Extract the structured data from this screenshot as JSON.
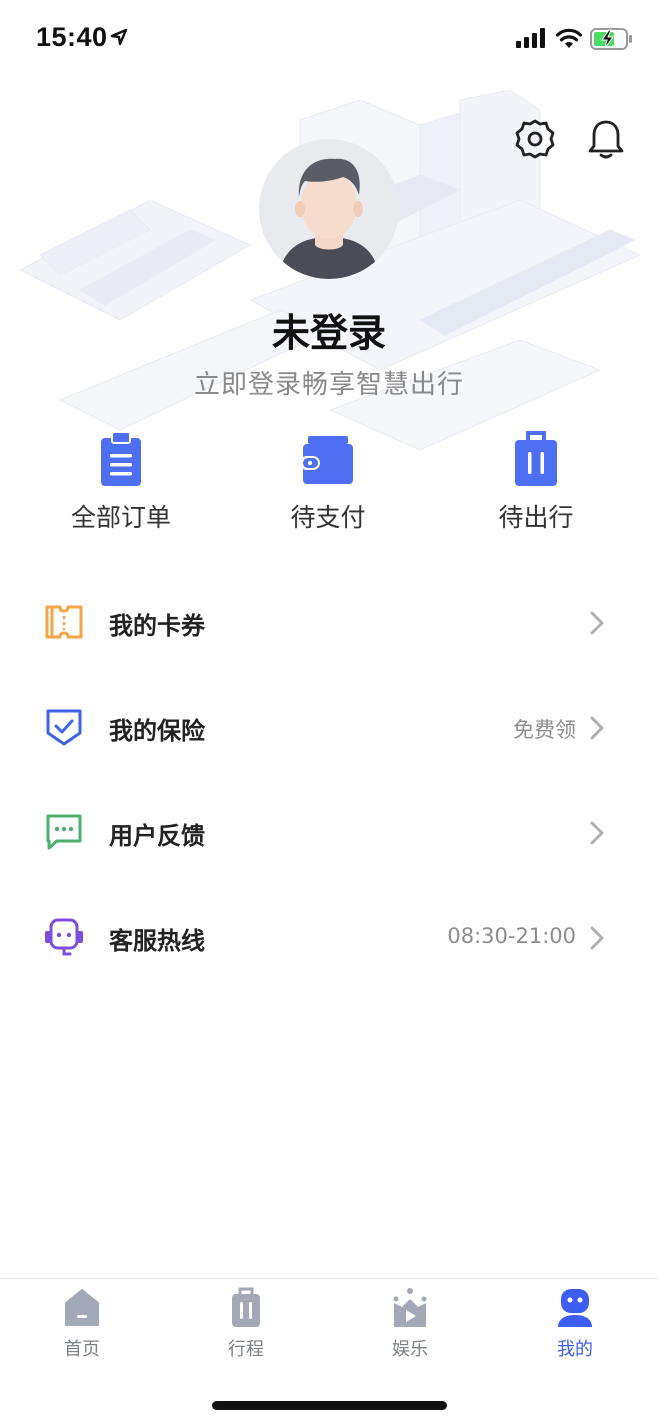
{
  "status_bar": {
    "time": "15:40",
    "location_icon": "location-arrow-icon",
    "signal_icon": "cellular-signal-icon",
    "wifi_icon": "wifi-icon",
    "battery_icon": "battery-charging-icon"
  },
  "header": {
    "settings_icon": "gear-icon",
    "notification_icon": "bell-icon",
    "title": "未登录",
    "subtitle": "立即登录畅享智慧出行"
  },
  "orders": [
    {
      "label": "全部订单",
      "icon": "clipboard-icon"
    },
    {
      "label": "待支付",
      "icon": "wallet-icon"
    },
    {
      "label": "待出行",
      "icon": "luggage-icon"
    }
  ],
  "menu": [
    {
      "label": "我的卡券",
      "value": "",
      "icon": "ticket-icon",
      "color": "#f2a647"
    },
    {
      "label": "我的保险",
      "value": "免费领",
      "icon": "shield-check-icon",
      "color": "#3d63e6"
    },
    {
      "label": "用户反馈",
      "value": "",
      "icon": "chat-bubble-icon",
      "color": "#4fb06d"
    },
    {
      "label": "客服热线",
      "value": "08:30-21:00",
      "icon": "headset-service-icon",
      "color": "#7a4fe0"
    }
  ],
  "tabbar": [
    {
      "label": "首页",
      "icon": "home-icon",
      "active": false
    },
    {
      "label": "行程",
      "icon": "luggage-icon",
      "active": false
    },
    {
      "label": "娱乐",
      "icon": "tv-play-icon",
      "active": false
    },
    {
      "label": "我的",
      "icon": "robot-profile-icon",
      "active": true
    }
  ],
  "colors": {
    "accent": "#3d5ef5",
    "order_icon": "#4e6ff2",
    "tab_inactive": "#a2a8b6",
    "muted_text": "#8a8a8a"
  }
}
